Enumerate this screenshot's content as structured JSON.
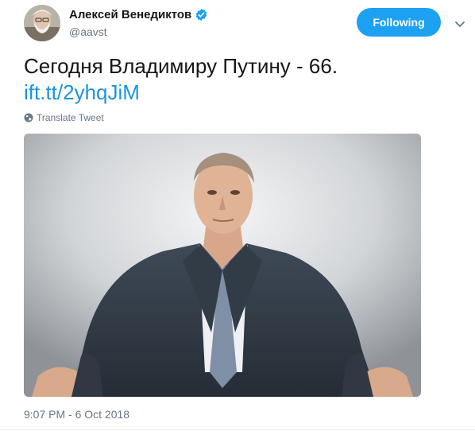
{
  "user": {
    "display_name": "Алексей Венедиктов",
    "handle": "@aavst",
    "verified": true,
    "avatar_icon": "avatar-photo"
  },
  "actions": {
    "follow_label": "Following",
    "caret_icon": "chevron-down-icon"
  },
  "tweet": {
    "text": "Сегодня Владимиру Путину - 66.",
    "link": "ift.tt/2yhqJiM",
    "translate_label": "Translate Tweet",
    "translate_icon": "globe-icon",
    "timestamp": "9:07 PM - 6 Oct 2018"
  },
  "colors": {
    "accent": "#1da1f2",
    "link": "#1b95e0",
    "muted": "#657786",
    "text": "#14171a"
  }
}
